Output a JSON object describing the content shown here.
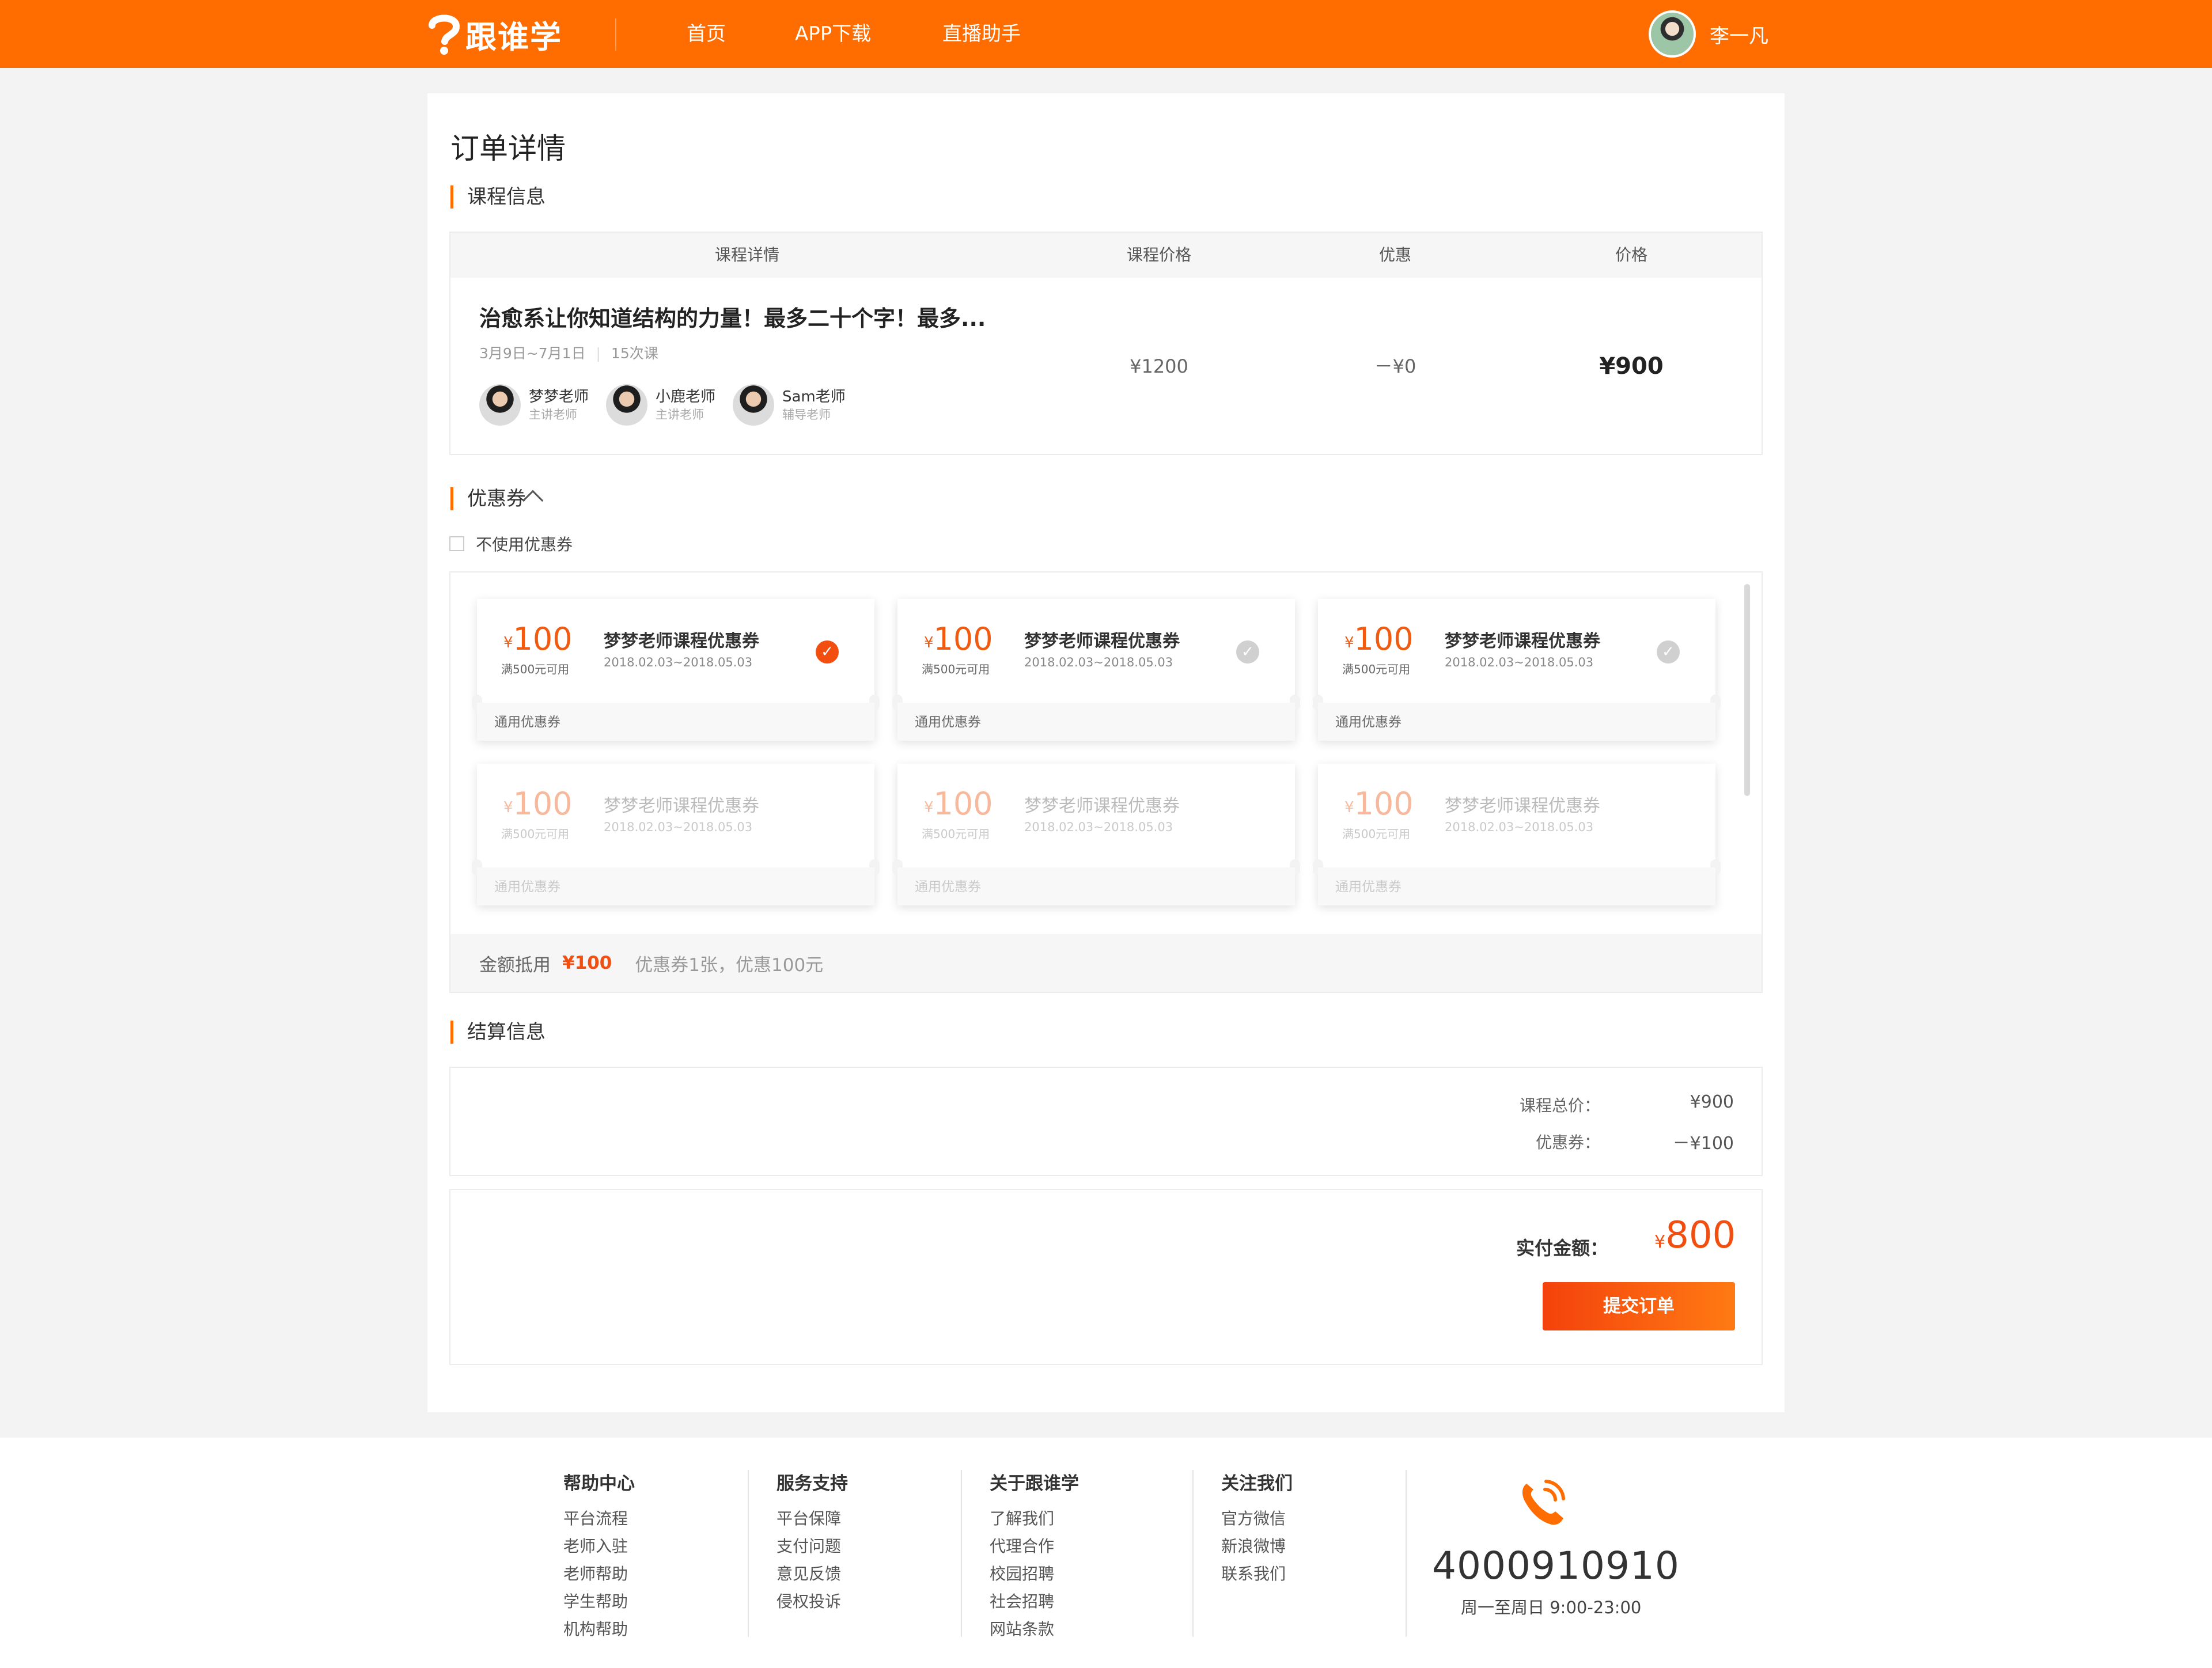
{
  "nav": {
    "logo_text": "跟谁学",
    "links": [
      "首页",
      "APP下载",
      "直播助手"
    ],
    "user_name": "李一凡"
  },
  "page_title": "订单详情",
  "course_section": {
    "title": "课程信息",
    "headers": [
      "课程详情",
      "课程价格",
      "优惠",
      "价格"
    ],
    "course": {
      "title": "治愈系让你知道结构的力量！最多二十个字！最多...",
      "dates": "3月9日~7月1日",
      "lessons": "15次课",
      "price": "¥1200",
      "discount": "－¥0",
      "total": "¥900",
      "teachers": [
        {
          "name": "梦梦老师",
          "role": "主讲老师"
        },
        {
          "name": "小鹿老师",
          "role": "主讲老师"
        },
        {
          "name": "Sam老师",
          "role": "辅导老师"
        }
      ]
    }
  },
  "coupon_section": {
    "title": "优惠券",
    "no_coupon_label": "不使用优惠券",
    "coupons": [
      {
        "currency": "¥",
        "amount": "100",
        "condition": "满500元可用",
        "name": "梦梦老师课程优惠券",
        "dates": "2018.02.03~2018.05.03",
        "type": "通用优惠券",
        "selected": true,
        "disabled": false
      },
      {
        "currency": "¥",
        "amount": "100",
        "condition": "满500元可用",
        "name": "梦梦老师课程优惠券",
        "dates": "2018.02.03~2018.05.03",
        "type": "通用优惠券",
        "selected": false,
        "disabled": false
      },
      {
        "currency": "¥",
        "amount": "100",
        "condition": "满500元可用",
        "name": "梦梦老师课程优惠券",
        "dates": "2018.02.03~2018.05.03",
        "type": "通用优惠券",
        "selected": false,
        "disabled": false
      },
      {
        "currency": "¥",
        "amount": "100",
        "condition": "满500元可用",
        "name": "梦梦老师课程优惠券",
        "dates": "2018.02.03~2018.05.03",
        "type": "通用优惠券",
        "selected": false,
        "disabled": true
      },
      {
        "currency": "¥",
        "amount": "100",
        "condition": "满500元可用",
        "name": "梦梦老师课程优惠券",
        "dates": "2018.02.03~2018.05.03",
        "type": "通用优惠券",
        "selected": false,
        "disabled": true
      },
      {
        "currency": "¥",
        "amount": "100",
        "condition": "满500元可用",
        "name": "梦梦老师课程优惠券",
        "dates": "2018.02.03~2018.05.03",
        "type": "通用优惠券",
        "selected": false,
        "disabled": true
      }
    ],
    "summary_label": "金额抵用",
    "summary_amount": "¥100",
    "summary_desc": "优惠券1张，优惠100元"
  },
  "settlement": {
    "title": "结算信息",
    "total_label": "课程总价：",
    "total_value": "¥900",
    "coupon_label": "优惠券：",
    "coupon_value": "－¥100",
    "pay_label": "实付金额：",
    "pay_currency": "¥",
    "pay_amount": "800",
    "submit_label": "提交订单"
  },
  "footer": {
    "columns": [
      {
        "title": "帮助中心",
        "items": [
          "平台流程",
          "老师入驻",
          "老师帮助",
          "学生帮助",
          "机构帮助"
        ]
      },
      {
        "title": "服务支持",
        "items": [
          "平台保障",
          "支付问题",
          "意见反馈",
          "侵权投诉"
        ]
      },
      {
        "title": "关于跟谁学",
        "items": [
          "了解我们",
          "代理合作",
          "校园招聘",
          "社会招聘",
          "网站条款"
        ]
      },
      {
        "title": "关注我们",
        "items": [
          "官方微信",
          "新浪微博",
          "联系我们"
        ]
      }
    ],
    "phone": "4000910910",
    "hours": "周一至周日 9:00-23:00"
  },
  "colors": {
    "brand": "#ff6c00",
    "accent": "#f24e0f"
  }
}
